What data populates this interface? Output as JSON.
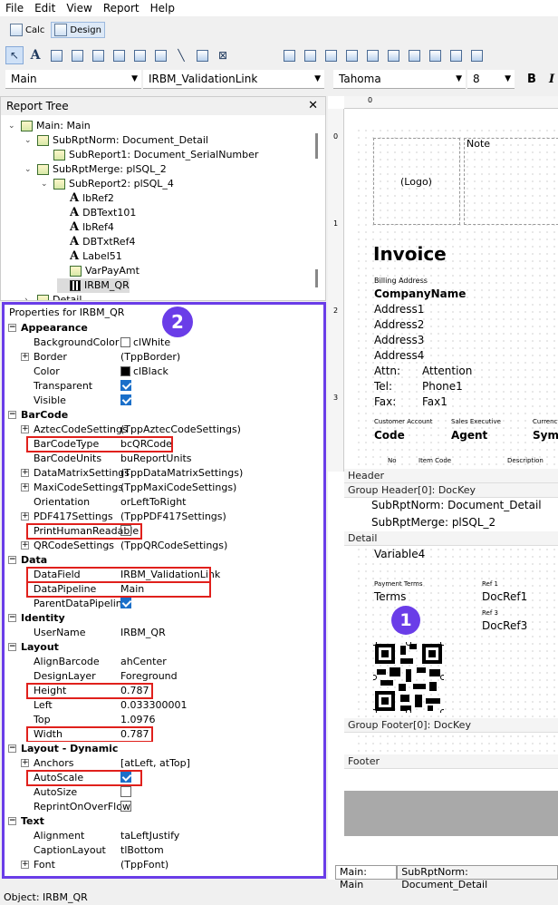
{
  "menu": [
    "File",
    "Edit",
    "View",
    "Report",
    "Help"
  ],
  "modes": {
    "calc": "Calc",
    "design": "Design"
  },
  "toolbar_icons": [
    "pointer-icon",
    "label-icon",
    "memo-icon",
    "richtext-icon",
    "dbcalc-icon",
    "dbtext-icon",
    "image-icon",
    "shape-icon",
    "line-icon",
    "barcode-icon",
    "subreport-icon"
  ],
  "combos": {
    "band": "Main",
    "component": "IRBM_ValidationLink",
    "font": "Tahoma",
    "size": "8",
    "bold": "B",
    "italic": "I"
  },
  "tree": {
    "title": "Report Tree",
    "items": [
      {
        "label": "Main: Main",
        "indent": 0,
        "icon": "report",
        "exp": "-"
      },
      {
        "label": "SubRptNorm: Document_Detail",
        "indent": 1,
        "icon": "report",
        "exp": "-"
      },
      {
        "label": "SubReport1: Document_SerialNumber",
        "indent": 2,
        "icon": "report",
        "exp": ""
      },
      {
        "label": "SubRptMerge: plSQL_2",
        "indent": 1,
        "icon": "report",
        "exp": "-"
      },
      {
        "label": "SubReport2: plSQL_4",
        "indent": 2,
        "icon": "report",
        "exp": "-"
      },
      {
        "label": "lbRef2",
        "indent": 3,
        "icon": "label",
        "exp": ""
      },
      {
        "label": "DBText101",
        "indent": 3,
        "icon": "label",
        "exp": ""
      },
      {
        "label": "lbRef4",
        "indent": 3,
        "icon": "label",
        "exp": ""
      },
      {
        "label": "DBTxtRef4",
        "indent": 3,
        "icon": "label",
        "exp": ""
      },
      {
        "label": "Label51",
        "indent": 3,
        "icon": "label",
        "exp": ""
      },
      {
        "label": "VarPayAmt",
        "indent": 3,
        "icon": "report",
        "exp": ""
      },
      {
        "label": "IRBM_QR",
        "indent": 3,
        "icon": "qr",
        "exp": "",
        "selected": true
      },
      {
        "label": "Detail",
        "indent": 1,
        "icon": "report",
        "exp": "+"
      }
    ]
  },
  "props": {
    "title": "Properties for IRBM_QR",
    "badge": "2",
    "rows": [
      {
        "t": "cat",
        "name": "Appearance"
      },
      {
        "name": "BackgroundColor",
        "value": "clWhite",
        "swatch": "#ffffff"
      },
      {
        "name": "Border",
        "value": "(TppBorder)",
        "plus": true
      },
      {
        "name": "Color",
        "value": "clBlack",
        "swatch": "#000000"
      },
      {
        "name": "Transparent",
        "check": true
      },
      {
        "name": "Visible",
        "check": true
      },
      {
        "t": "cat",
        "name": "BarCode"
      },
      {
        "name": "AztecCodeSettings",
        "value": "(TppAztecCodeSettings)",
        "plus": true
      },
      {
        "name": "BarCodeType",
        "value": "bcQRCode"
      },
      {
        "name": "BarCodeUnits",
        "value": "buReportUnits"
      },
      {
        "name": "DataMatrixSettings",
        "value": "(TppDataMatrixSettings)",
        "plus": true
      },
      {
        "name": "MaxiCodeSettings",
        "value": "(TppMaxiCodeSettings)",
        "plus": true
      },
      {
        "name": "Orientation",
        "value": "orLeftToRight"
      },
      {
        "name": "PDF417Settings",
        "value": "(TppPDF417Settings)",
        "plus": true
      },
      {
        "name": "PrintHumanReadable",
        "check": false
      },
      {
        "name": "QRCodeSettings",
        "value": "(TppQRCodeSettings)",
        "plus": true
      },
      {
        "t": "cat",
        "name": "Data"
      },
      {
        "name": "DataField",
        "value": "IRBM_ValidationLink"
      },
      {
        "name": "DataPipeline",
        "value": "Main"
      },
      {
        "name": "ParentDataPipeline",
        "check": true
      },
      {
        "t": "cat",
        "name": "Identity"
      },
      {
        "name": "UserName",
        "value": "IRBM_QR"
      },
      {
        "t": "cat",
        "name": "Layout"
      },
      {
        "name": "AlignBarcode",
        "value": "ahCenter"
      },
      {
        "name": "DesignLayer",
        "value": "Foreground"
      },
      {
        "name": "Height",
        "value": "0.787"
      },
      {
        "name": "Left",
        "value": "0.033300001"
      },
      {
        "name": "Top",
        "value": "1.0976"
      },
      {
        "name": "Width",
        "value": "0.787"
      },
      {
        "t": "cat",
        "name": "Layout - Dynamic"
      },
      {
        "name": "Anchors",
        "value": "[atLeft, atTop]",
        "plus": true
      },
      {
        "name": "AutoScale",
        "check": true
      },
      {
        "name": "AutoSize",
        "check": false
      },
      {
        "name": "ReprintOnOverFlow",
        "check": false
      },
      {
        "t": "cat",
        "name": "Text"
      },
      {
        "name": "Alignment",
        "value": "taLeftJustify"
      },
      {
        "name": "CaptionLayout",
        "value": "tlBottom"
      },
      {
        "name": "Font",
        "value": "(TppFont)",
        "plus": true
      }
    ]
  },
  "design": {
    "logo": "(Logo)",
    "note": "Note",
    "invoice": "Invoice",
    "billing": "Billing Address",
    "company": "CompanyName",
    "addr1": "Address1",
    "addr2": "Address2",
    "addr3": "Address3",
    "addr4": "Address4",
    "attn_l": "Attn:",
    "attn_v": "Attention",
    "tel_l": "Tel:",
    "tel_v": "Phone1",
    "fax_l": "Fax:",
    "fax_v": "Fax1",
    "cust_acc": "Customer Account",
    "sales_exec": "Sales Executive",
    "curr": "Currency",
    "code": "Code",
    "agent": "Agent",
    "sym": "Sym",
    "no": "No",
    "item_code": "Item Code",
    "desc": "Description",
    "hdr_header": "Header",
    "hdr_group": "Group Header[0]: DocKey",
    "sub1": "SubRptNorm: Document_Detail",
    "sub2": "SubRptMerge: plSQL_2",
    "hdr_detail": "Detail",
    "var4": "Variable4",
    "pay_terms": "Payment Terms",
    "terms": "Terms",
    "ref1": "Ref 1",
    "docref1": "DocRef1",
    "ref3": "Ref 3",
    "docref3": "DocRef3",
    "badge": "1",
    "hdr_gfooter": "Group Footer[0]: DocKey",
    "hdr_footer": "Footer",
    "rulers": [
      "0",
      "1",
      "2",
      "3",
      "0",
      "1",
      "0"
    ]
  },
  "tabs": [
    "Main: Main",
    "SubRptNorm: Document_Detail"
  ],
  "status": "Object: IRBM_QR",
  "colors": {
    "accent": "#6a3de8",
    "highlight": "#e0201c",
    "check": "#1a6fc9"
  }
}
